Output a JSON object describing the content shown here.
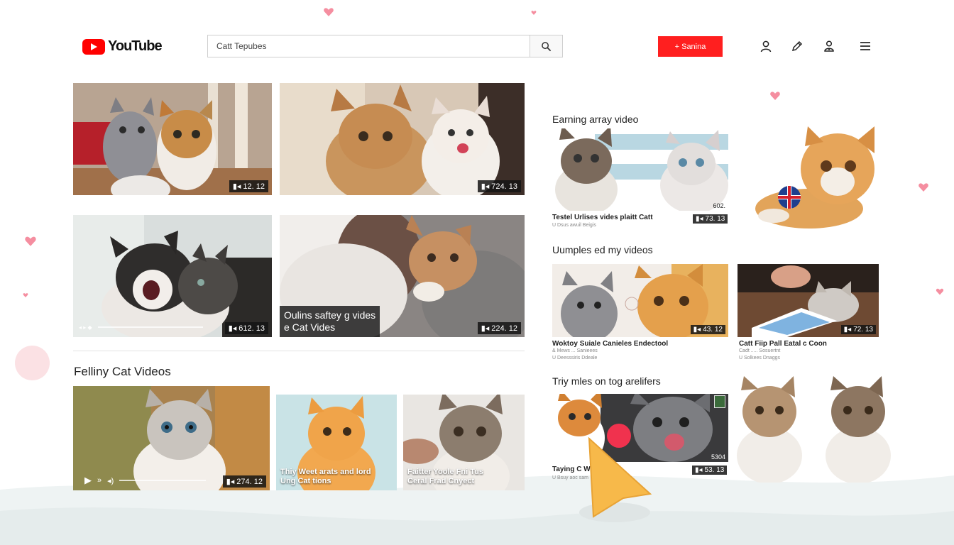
{
  "header": {
    "logo_text": "YouTube",
    "search_value": "Catt Tepubes",
    "red_button_label": "+ Sanina",
    "icons": [
      "user-icon",
      "edit-icon",
      "account-icon",
      "menu-icon"
    ]
  },
  "grid": [
    {
      "badge": "12. 12"
    },
    {
      "badge": "724. 13"
    },
    {
      "badge": "612. 13"
    },
    {
      "badge": "224. 12",
      "overlay": "Oulins saftey g vides\ne Cat Vides"
    }
  ],
  "section": {
    "title": "Felliny Cat Videos",
    "main_badge": "274. 12",
    "card2_caption": "Thiy Weet arats and lord\nUng Cat tions",
    "card3_caption": "Faitter Yoole Fni Tus\nCeral Frad Cnyect"
  },
  "right": {
    "s1": {
      "title": "Earning array video",
      "vid_title": "Testel Urlises vides plaitt Catt",
      "vid_sub": "U Dsus awuil Beigis",
      "badge": "73. 13",
      "corner": "602."
    },
    "s2": {
      "title": "Uumples ed my videos",
      "v1_title": "Woktoy Suiale Canieles Endectool",
      "v1_sub1": "& Mews ... Sanieees",
      "v1_sub2": "U Deesssiris Ddeale",
      "v1_badge": "43. 12",
      "v2_title": "Catt Fiip Pall Eatal c Coon",
      "v2_sub1": "Cadt ..... Sosuertnt",
      "v2_sub2": "U Solkees Dnaggs",
      "v2_badge": "72. 13"
    },
    "s3": {
      "title": "Triy mles on tog arelifers",
      "vid_title": "Taying C        Wilebeil",
      "vid_sub": "U Bsuy aoc sam",
      "badge": "53. 13",
      "corner": "5304"
    }
  },
  "colors": {
    "brand_red": "#ff0000",
    "button_red": "#ff1f1f",
    "heart_pink": "#f58ea0",
    "cursor_orange": "#f7b94a"
  }
}
